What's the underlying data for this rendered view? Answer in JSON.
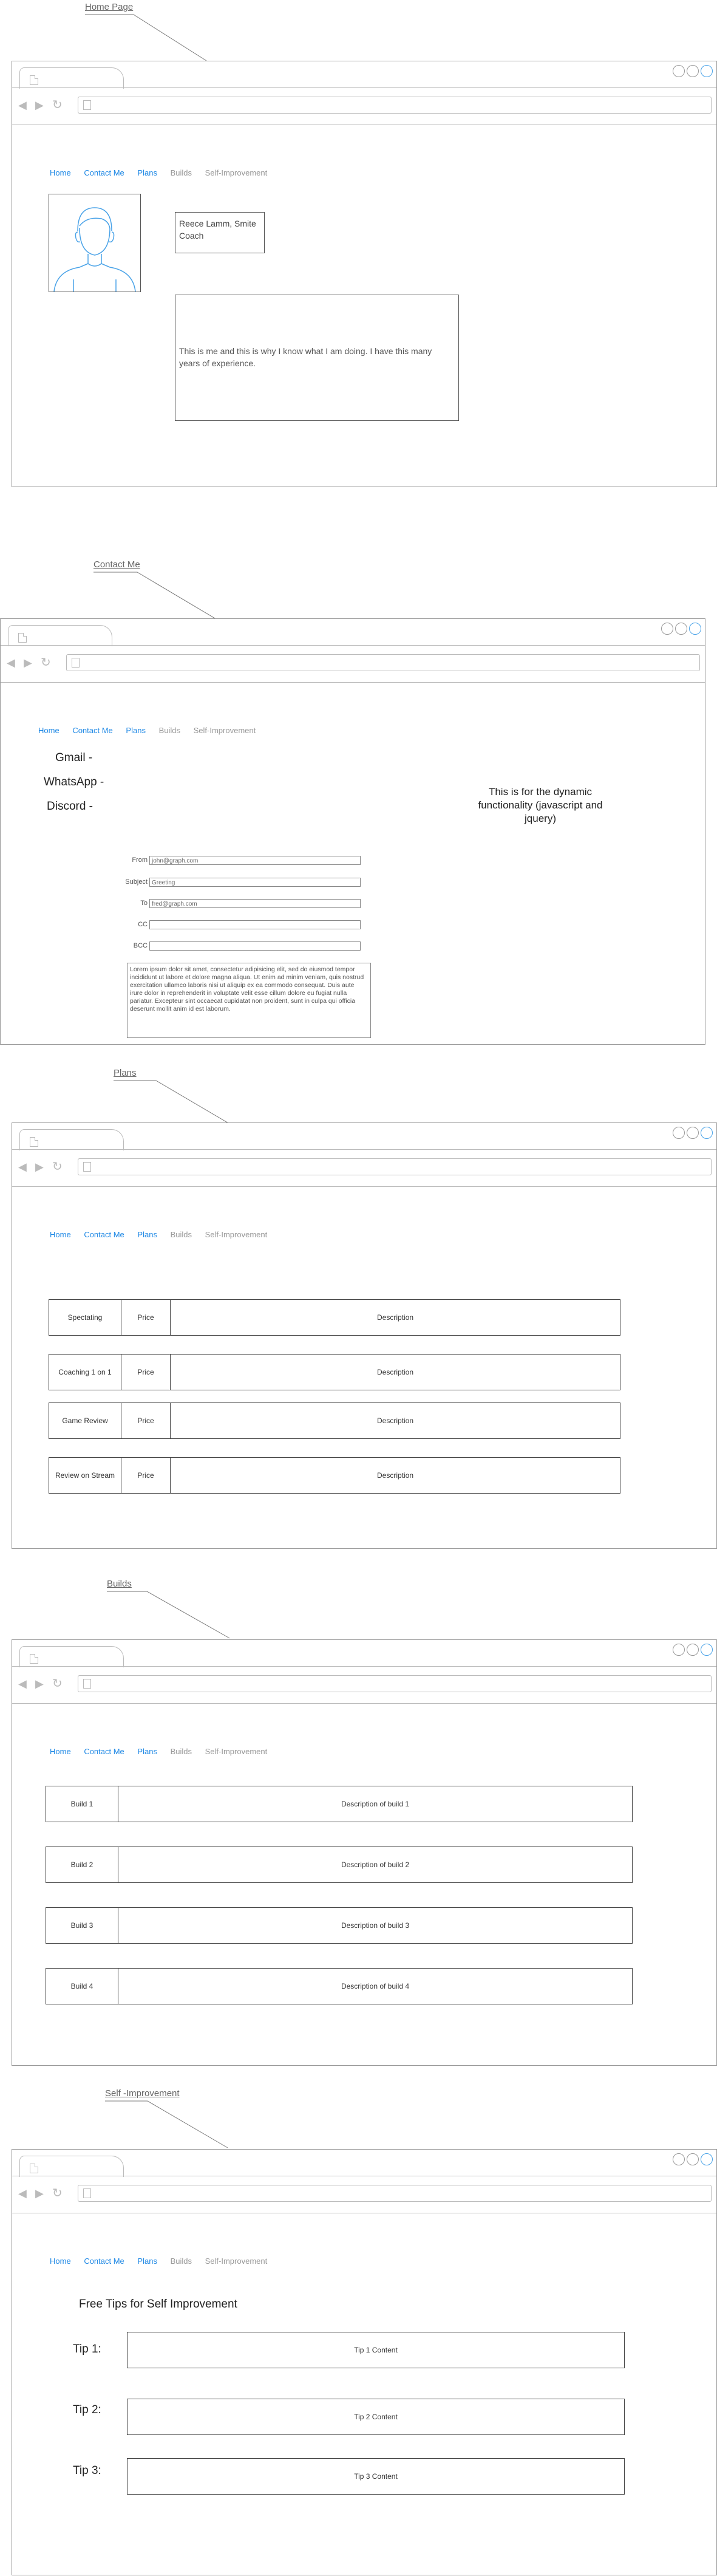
{
  "nav": {
    "home": "Home",
    "contact": "Contact Me",
    "plans": "Plans",
    "builds": "Builds",
    "self": "Self-Improvement"
  },
  "pages": {
    "home": {
      "callout": "Home Page",
      "name_card": "Reece Lamm, Smite Coach",
      "bio": "This is me and this is why I know what I am doing. I have this many years of experience."
    },
    "contact": {
      "callout": "Contact Me",
      "contacts": [
        "Gmail -",
        "WhatsApp -",
        "Discord -"
      ],
      "note": "This is for the dynamic functionality (javascript and jquery)",
      "form": {
        "from_label": "From",
        "from_value": "john@graph.com",
        "subject_label": "Subject",
        "subject_value": "Greeting",
        "to_label": "To",
        "to_value": "fred@graph.com",
        "cc_label": "CC",
        "bcc_label": "BCC",
        "body": "Lorem ipsum dolor sit amet, consectetur adipisicing elit, sed do eiusmod tempor incididunt ut labore et dolore magna aliqua. Ut enim ad minim veniam, quis nostrud exercitation ullamco laboris nisi ut aliquip ex ea commodo consequat. Duis aute irure dolor in reprehenderit in voluptate velit esse cillum dolore eu fugiat nulla pariatur. Excepteur sint occaecat cupidatat non proident, sunt in culpa qui officia deserunt mollit anim id est laborum."
      }
    },
    "plans": {
      "callout": "Plans",
      "rows": [
        {
          "name": "Spectating",
          "price": "Price",
          "desc": "Description"
        },
        {
          "name": "Coaching 1 on 1",
          "price": "Price",
          "desc": "Description"
        },
        {
          "name": "Game Review",
          "price": "Price",
          "desc": "Description"
        },
        {
          "name": "Review on Stream",
          "price": "Price",
          "desc": "Description"
        }
      ]
    },
    "builds": {
      "callout": "Builds",
      "rows": [
        {
          "name": "Build 1",
          "desc": "Description of build 1"
        },
        {
          "name": "Build 2",
          "desc": "Description of build 2"
        },
        {
          "name": "Build 3",
          "desc": "Description of build 3"
        },
        {
          "name": "Build 4",
          "desc": "Description of build 4"
        }
      ]
    },
    "self": {
      "callout": "Self -Improvement",
      "heading": "Free Tips for Self Improvement",
      "tips": [
        {
          "label": "Tip 1:",
          "content": "Tip 1 Content"
        },
        {
          "label": "Tip 2:",
          "content": "Tip 2 Content"
        },
        {
          "label": "Tip 3:",
          "content": "Tip 3 Content"
        }
      ]
    }
  }
}
